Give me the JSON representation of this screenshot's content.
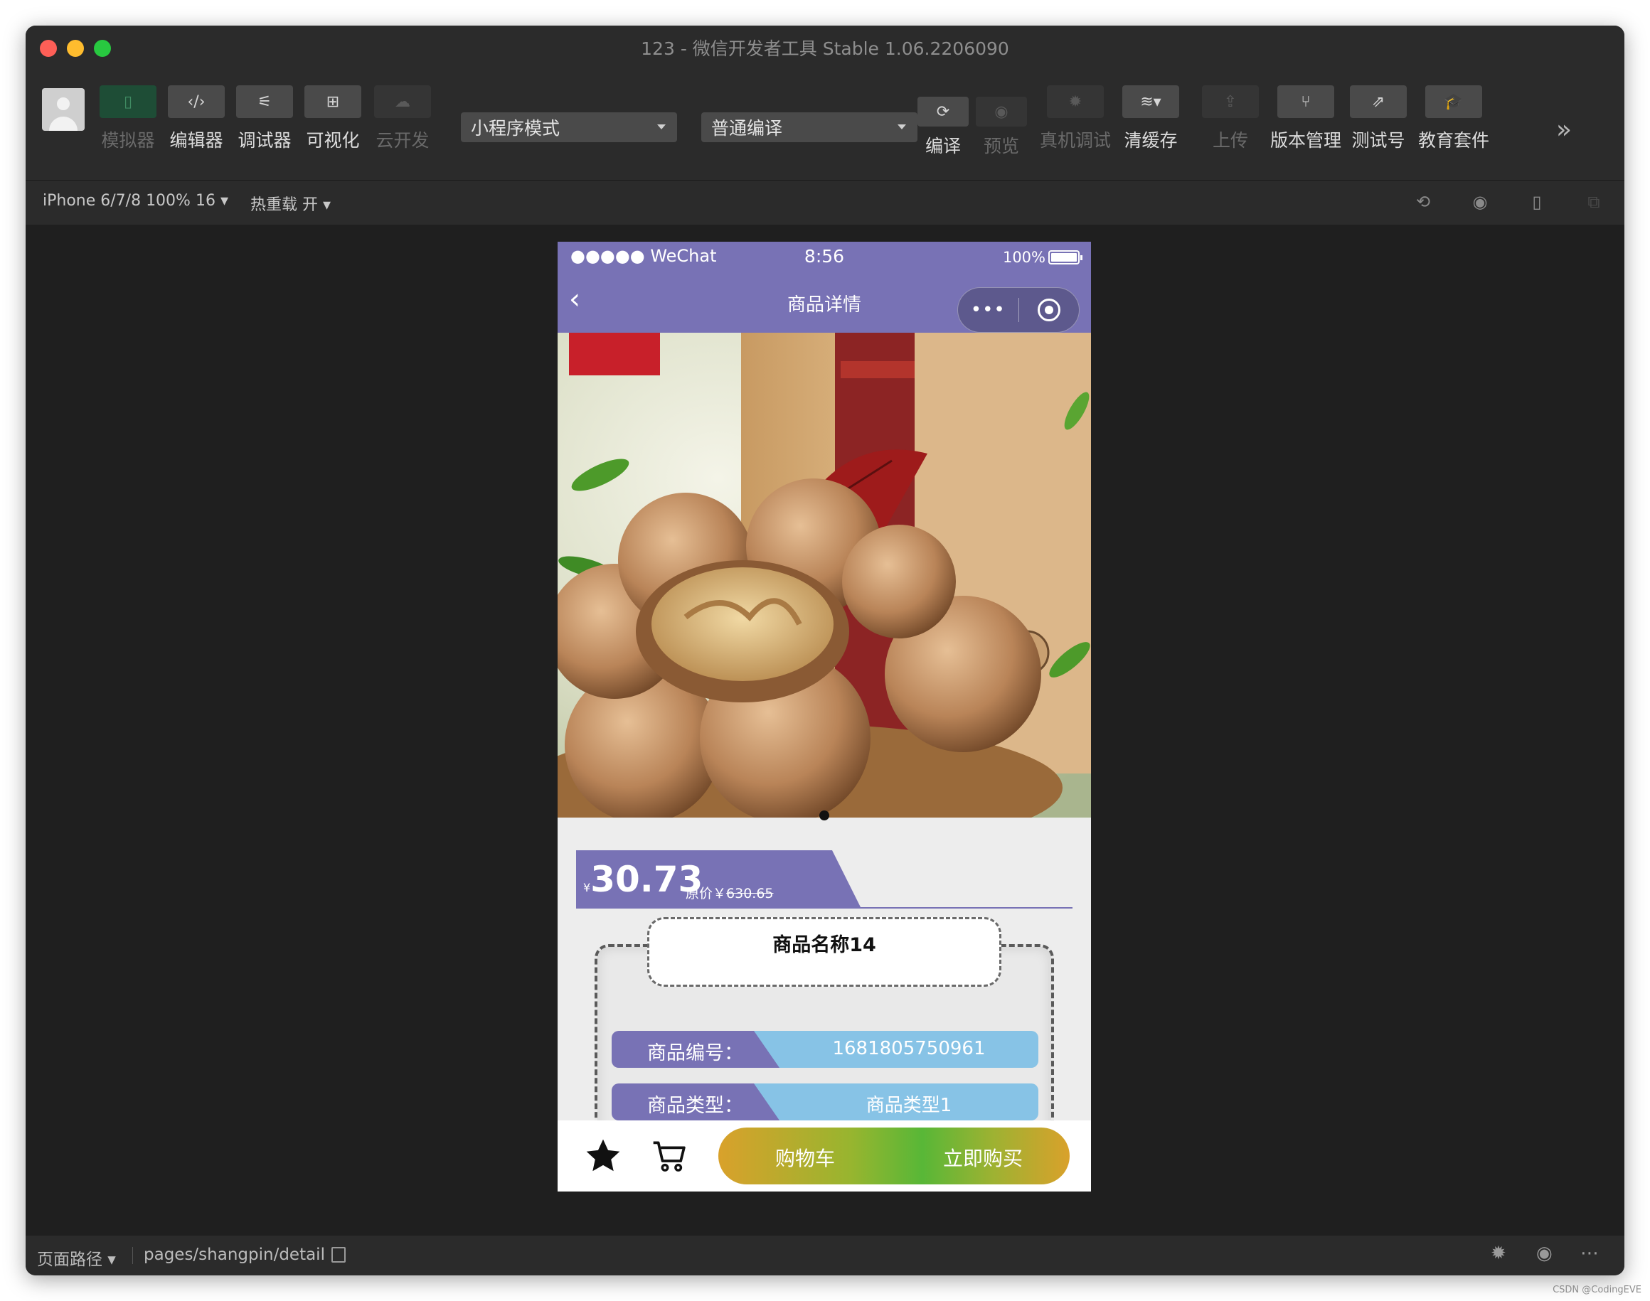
{
  "window": {
    "title": "123 - 微信开发者工具 Stable 1.06.2206090"
  },
  "toolbar": {
    "simulator": "模拟器",
    "editor": "编辑器",
    "debugger": "调试器",
    "visual": "可视化",
    "cloud": "云开发",
    "mode_select": "小程序模式",
    "compile_select": "普通编译",
    "compile": "编译",
    "preview": "预览",
    "remote_debug": "真机调试",
    "clear_cache": "清缓存",
    "upload": "上传",
    "version": "版本管理",
    "test_id": "测试号",
    "edu": "教育套件"
  },
  "subbar": {
    "device": "iPhone 6/7/8 100% 16 ▾",
    "hot_reload": "热重载 开 ▾"
  },
  "phone": {
    "status": {
      "carrier": "●●●●● WeChat",
      "time": "8:56",
      "battery": "100%"
    },
    "nav_title": "商品详情",
    "capsule_more": "•••",
    "price": {
      "currency": "¥",
      "value": "30.73",
      "orig_label": "原价￥",
      "orig_value": "630.65"
    },
    "name": "商品名称14",
    "info": [
      {
        "label": "商品编号：",
        "value": "1681805750961"
      },
      {
        "label": "商品类型：",
        "value": "商品类型1"
      }
    ],
    "bottom": {
      "cart": "购物车",
      "buy": "立即购买"
    }
  },
  "footer": {
    "path_label": "页面路径 ▾",
    "path": "pages/shangpin/detail"
  },
  "watermark": "CSDN @CodingEVE",
  "colors": {
    "accent": "#7872b5",
    "info_value_bg": "#87c3e6"
  }
}
